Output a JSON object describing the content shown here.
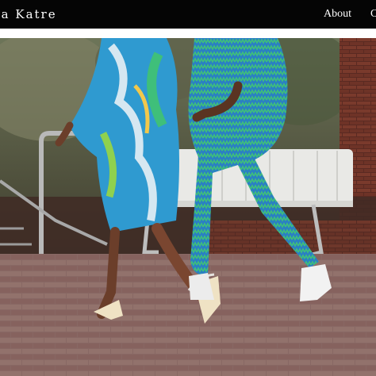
{
  "header": {
    "brand": "na Katre",
    "nav": [
      {
        "label": "About"
      },
      {
        "label": "C"
      }
    ]
  },
  "hero": {
    "image": "photo of two people walking in patterned blue and green outfits",
    "colors": {
      "pavement": "#8e6b66",
      "brick_wall": "#7a3a2c",
      "fabric_blue": "#2f9ad0",
      "fabric_green": "#2faa6a"
    }
  }
}
